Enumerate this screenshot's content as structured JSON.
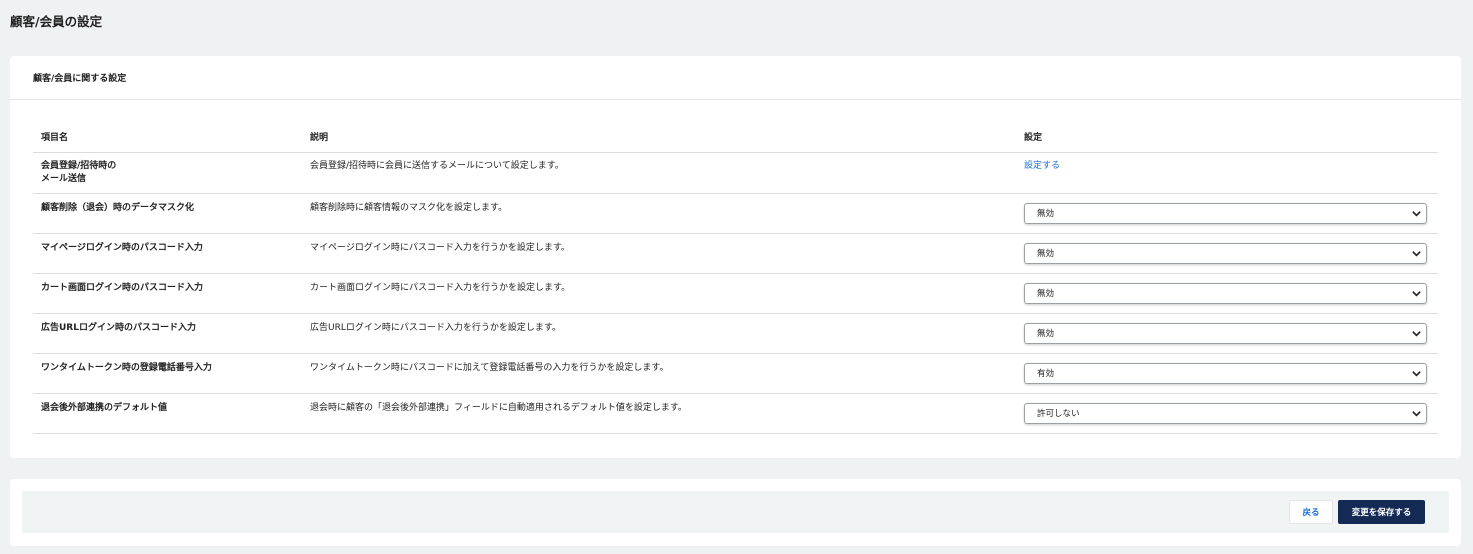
{
  "page": {
    "title": "顧客/会員の設定"
  },
  "card": {
    "title": "顧客/会員に関する設定"
  },
  "table": {
    "headers": [
      "項目名",
      "説明",
      "設定"
    ],
    "rows": [
      {
        "name_line1": "会員登録/招待時の",
        "name_line2": "メール送信",
        "description": "会員登録/招待時に会員に送信するメールについて設定します。",
        "link": "設定する"
      },
      {
        "name": "顧客削除（退会）時のデータマスク化",
        "description": "顧客削除時に顧客情報のマスク化を設定します。",
        "value": "無効"
      },
      {
        "name": "マイページログイン時のパスコード入力",
        "description": "マイページログイン時にパスコード入力を行うかを設定します。",
        "value": "無効"
      },
      {
        "name": "カート画面ログイン時のパスコード入力",
        "description": "カート画面ログイン時にパスコード入力を行うかを設定します。",
        "value": "無効"
      },
      {
        "name": "広告URLログイン時のパスコード入力",
        "description": "広告URLログイン時にパスコード入力を行うかを設定します。",
        "value": "無効"
      },
      {
        "name": "ワンタイムトークン時の登録電話番号入力",
        "description": "ワンタイムトークン時にパスコードに加えて登録電話番号の入力を行うかを設定します。",
        "value": "有効"
      },
      {
        "name": "退会後外部連携のデフォルト値",
        "description": "退会時に顧客の「退会後外部連携」フィールドに自動適用されるデフォルト値を設定します。",
        "value": "許可しない"
      }
    ]
  },
  "footer": {
    "back_label": "戻る",
    "save_label": "変更を保存する"
  },
  "icons": {
    "select": "chevron-down-icon"
  },
  "colors": {
    "primary": "#142a55",
    "link": "#1a6fd8",
    "background": "#eff2f3"
  }
}
